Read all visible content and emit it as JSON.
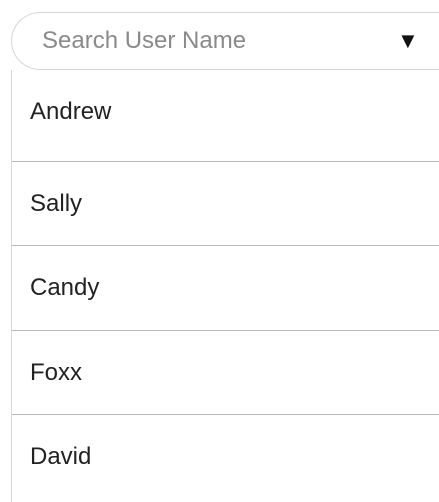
{
  "search": {
    "placeholder": "Search User Name",
    "value": "",
    "arrow_icon": "triangle-down-icon"
  },
  "dropdown": {
    "items": [
      {
        "label": "Andrew"
      },
      {
        "label": "Sally"
      },
      {
        "label": "Candy"
      },
      {
        "label": "Foxx"
      },
      {
        "label": "David"
      }
    ]
  },
  "colors": {
    "border": "#d6d6d6",
    "divider": "#b9b9b9",
    "text": "#222222",
    "placeholder": "#8a8a8a"
  }
}
